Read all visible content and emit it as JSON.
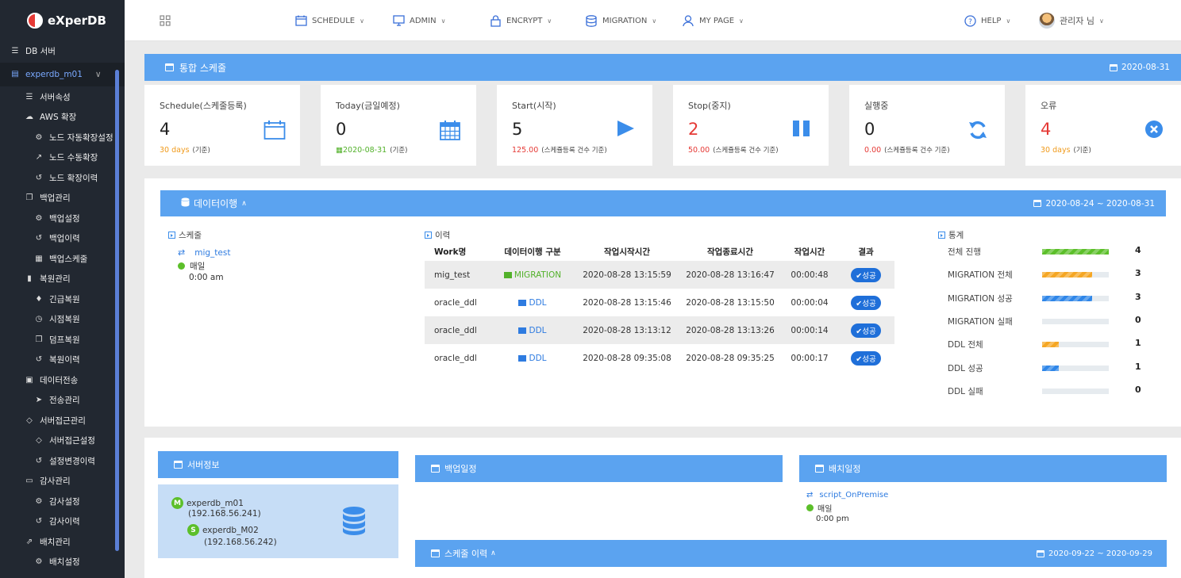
{
  "brand": {
    "name": "eXperDB"
  },
  "sidebar": {
    "items": [
      {
        "label": "DB 서버",
        "icon": "database-icon",
        "level": 0
      },
      {
        "label": "experdb_m01",
        "icon": "server-icon",
        "level": 0,
        "active": true
      },
      {
        "label": "서버속성",
        "icon": "list-icon",
        "level": 1
      },
      {
        "label": "AWS 확장",
        "icon": "cloud-icon",
        "level": 1
      },
      {
        "label": "노드 자동확장설정",
        "icon": "gear-icon",
        "level": 2
      },
      {
        "label": "노드 수동확장",
        "icon": "resize-icon",
        "level": 2
      },
      {
        "label": "노드 확장이력",
        "icon": "history-icon",
        "level": 2
      },
      {
        "label": "백업관리",
        "icon": "copy-icon",
        "level": 1
      },
      {
        "label": "백업설정",
        "icon": "gear-icon",
        "level": 2
      },
      {
        "label": "백업이력",
        "icon": "history-icon",
        "level": 2
      },
      {
        "label": "백업스케줄",
        "icon": "calendar-icon",
        "level": 2
      },
      {
        "label": "복원관리",
        "icon": "file-icon",
        "level": 1
      },
      {
        "label": "긴급복원",
        "icon": "bell-icon",
        "level": 2
      },
      {
        "label": "시점복원",
        "icon": "clock-icon",
        "level": 2
      },
      {
        "label": "덤프복원",
        "icon": "clone-icon",
        "level": 2
      },
      {
        "label": "복원이력",
        "icon": "history-icon",
        "level": 2
      },
      {
        "label": "데이터전송",
        "icon": "hdd-icon",
        "level": 1
      },
      {
        "label": "전송관리",
        "icon": "send-icon",
        "level": 2
      },
      {
        "label": "서버접근관리",
        "icon": "lock-icon",
        "level": 1
      },
      {
        "label": "서버접근설정",
        "icon": "lock-icon",
        "level": 2
      },
      {
        "label": "설정변경이력",
        "icon": "history-icon",
        "level": 2
      },
      {
        "label": "감사관리",
        "icon": "monitor-icon",
        "level": 1
      },
      {
        "label": "감사설정",
        "icon": "gear-icon",
        "level": 2
      },
      {
        "label": "감사이력",
        "icon": "history-icon",
        "level": 2
      },
      {
        "label": "배치관리",
        "icon": "export-icon",
        "level": 1
      },
      {
        "label": "배치설정",
        "icon": "gear-icon",
        "level": 2
      }
    ]
  },
  "topnav": {
    "items": [
      {
        "label": "SCHEDULE",
        "icon": "calendar-icon"
      },
      {
        "label": "ADMIN",
        "icon": "monitor-icon"
      },
      {
        "label": "ENCRYPT",
        "icon": "lock-icon"
      },
      {
        "label": "MIGRATION",
        "icon": "database-icon"
      },
      {
        "label": "MY PAGE",
        "icon": "user-icon"
      }
    ],
    "help": "HELP",
    "user": "관리자 님",
    "colors": {
      "accent": "#3a6fd8",
      "panel": "#5ba3f0",
      "sidebar": "#222831"
    }
  },
  "schedule": {
    "title": "통합 스케줄",
    "date": "2020-08-31",
    "cards": [
      {
        "title": "Schedule(스케줄등록)",
        "value": "4",
        "sub_value": "30 days",
        "sub_note": "(기준)",
        "sub_color": "orange",
        "icon": "calendar-outline-icon"
      },
      {
        "title": "Today(금일예정)",
        "value": "0",
        "sub_value": "2020-08-31",
        "sub_note": "(기준)",
        "sub_color": "green",
        "icon": "calendar-grid-icon"
      },
      {
        "title": "Start(시작)",
        "value": "5",
        "sub_value": "125.00",
        "sub_note": "(스케쥴등록 건수 기준)",
        "sub_color": "red",
        "icon": "play-icon"
      },
      {
        "title": "Stop(중지)",
        "value": "2",
        "value_red": true,
        "sub_value": "50.00",
        "sub_note": "(스케쥴등록 건수 기준)",
        "sub_color": "red",
        "icon": "pause-icon"
      },
      {
        "title": "실행중",
        "value": "0",
        "sub_value": "0.00",
        "sub_note": "(스케쥴등록 건수 기준)",
        "sub_color": "red",
        "icon": "refresh-icon"
      },
      {
        "title": "오류",
        "value": "4",
        "value_red": true,
        "sub_value": "30 days",
        "sub_note": "(기준)",
        "sub_color": "orange",
        "icon": "close-circle-icon"
      }
    ]
  },
  "migration": {
    "title": "데이터이행",
    "date_range": "2020-08-24 ~ 2020-08-31",
    "schedule": {
      "title": "스케줄",
      "name": "mig_test",
      "frequency": "매일",
      "time": "0:00 am"
    },
    "history": {
      "title": "이력",
      "columns": [
        "Work명",
        "데이터이행 구분",
        "작업시작시간",
        "작업종료시간",
        "작업시간",
        "결과"
      ],
      "rows": [
        {
          "work": "mig_test",
          "type": "MIGRATION",
          "start": "2020-08-28 13:15:59",
          "end": "2020-08-28 13:16:47",
          "duration": "00:00:48",
          "result": "성공"
        },
        {
          "work": "oracle_ddl",
          "type": "DDL",
          "start": "2020-08-28 13:15:46",
          "end": "2020-08-28 13:15:50",
          "duration": "00:00:04",
          "result": "성공"
        },
        {
          "work": "oracle_ddl",
          "type": "DDL",
          "start": "2020-08-28 13:13:12",
          "end": "2020-08-28 13:13:26",
          "duration": "00:00:14",
          "result": "성공"
        },
        {
          "work": "oracle_ddl",
          "type": "DDL",
          "start": "2020-08-28 09:35:08",
          "end": "2020-08-28 09:35:25",
          "duration": "00:00:17",
          "result": "성공"
        }
      ]
    },
    "stats": {
      "title": "통계",
      "rows": [
        {
          "label": "전체 진행",
          "value": "4",
          "fraction": 1.0,
          "color": "#5cbf2a"
        },
        {
          "label": "MIGRATION 전체",
          "value": "3",
          "fraction": 0.75,
          "color": "#f5a623"
        },
        {
          "label": "MIGRATION 성공",
          "value": "3",
          "fraction": 0.75,
          "color": "#2f86e8"
        },
        {
          "label": "MIGRATION 실패",
          "value": "0",
          "fraction": 0.0,
          "color": "#2f86e8"
        },
        {
          "label": "DDL 전체",
          "value": "1",
          "fraction": 0.25,
          "color": "#f5a623"
        },
        {
          "label": "DDL 성공",
          "value": "1",
          "fraction": 0.25,
          "color": "#2f86e8"
        },
        {
          "label": "DDL 실패",
          "value": "0",
          "fraction": 0.0,
          "color": "#2f86e8"
        }
      ]
    }
  },
  "bottom": {
    "server_info": {
      "title": "서버정보",
      "master": {
        "badge": "M",
        "name": "experdb_m01",
        "ip": "(192.168.56.241)"
      },
      "slave": {
        "badge": "S",
        "name": "experdb_M02",
        "ip": "(192.168.56.242)"
      }
    },
    "backup": {
      "title": "백업일정"
    },
    "batch": {
      "title": "배치일정",
      "name": "script_OnPremise",
      "frequency": "매일",
      "time": "0:00 pm"
    },
    "history": {
      "title": "스케줄 이력",
      "date_range": "2020-09-22 ~ 2020-09-29"
    }
  }
}
